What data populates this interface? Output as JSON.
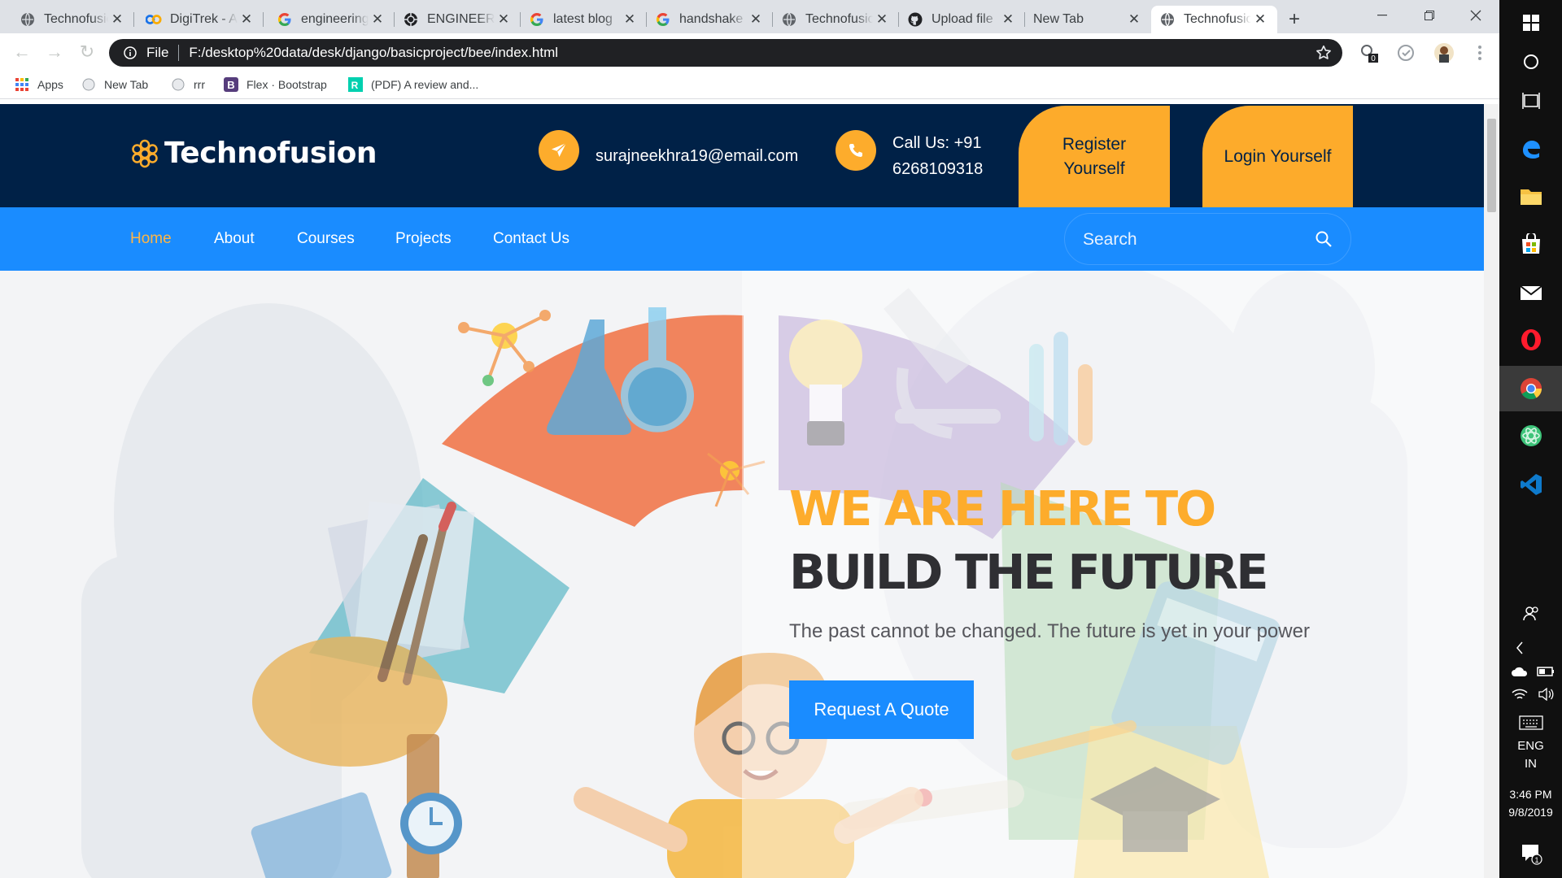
{
  "tabs": [
    {
      "title": "Technofusion",
      "favicon": "globe-icon"
    },
    {
      "title": "DigiTrek - A",
      "favicon": "digitrek-icon"
    },
    {
      "title": "engineering",
      "favicon": "google-icon"
    },
    {
      "title": "ENGINEERING",
      "favicon": "engineering-icon"
    },
    {
      "title": "latest blog",
      "favicon": "google-icon"
    },
    {
      "title": "handshake",
      "favicon": "google-icon"
    },
    {
      "title": "Technofusion",
      "favicon": "globe-icon"
    },
    {
      "title": "Upload file",
      "favicon": "github-icon"
    },
    {
      "title": "New Tab",
      "favicon": ""
    },
    {
      "title": "Technofusion",
      "favicon": "globe-icon",
      "active": true
    }
  ],
  "address": {
    "scheme": "File",
    "url": "F:/desktop%20data/desk/django/basicproject/bee/index.html"
  },
  "extensions": {
    "badge_count": "0"
  },
  "bookmarks": [
    {
      "label": "Apps",
      "icon": "apps-grid-icon"
    },
    {
      "label": "New Tab",
      "icon": "globe-icon"
    },
    {
      "label": "rrr",
      "icon": "globe-icon"
    },
    {
      "label": "Flex · Bootstrap",
      "icon": "bootstrap-icon"
    },
    {
      "label": "(PDF) A review and...",
      "icon": "researchgate-icon"
    }
  ],
  "site": {
    "brand": "Technofusion",
    "email": "surajneekhra19@email.com",
    "call_line1": "Call Us: +91",
    "call_line2": "6268109318",
    "register_line1": "Register",
    "register_line2": "Yourself",
    "login": "Login Yourself",
    "nav": [
      "Home",
      "About",
      "Courses",
      "Projects",
      "Contact Us"
    ],
    "search_placeholder": "Search",
    "hero_line1": "WE ARE HERE TO",
    "hero_line2": "BUILD THE FUTURE",
    "hero_sub": "The past cannot be changed. The future is yet in your power",
    "hero_cta": "Request A Quote",
    "colors": {
      "navy": "#002147",
      "blue": "#1a8cff",
      "orange": "#fdac2c"
    }
  },
  "taskbar": {
    "lang_line1": "ENG",
    "lang_line2": "IN",
    "time": "3:46 PM",
    "date": "9/8/2019",
    "notification_count": "1"
  }
}
